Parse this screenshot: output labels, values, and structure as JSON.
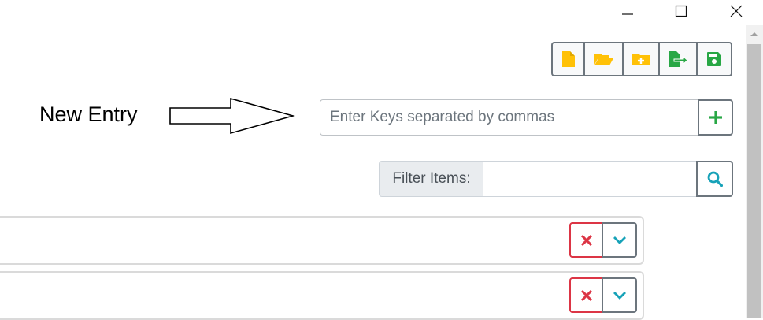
{
  "window": {
    "controls": [
      "minimize-icon",
      "maximize-icon",
      "close-icon"
    ]
  },
  "toolbar": {
    "buttons": [
      {
        "name": "new-file",
        "icon": "file-icon",
        "color": "#ffc107"
      },
      {
        "name": "open-folder",
        "icon": "folder-open-icon",
        "color": "#ffc107"
      },
      {
        "name": "add-folder",
        "icon": "folder-plus-icon",
        "color": "#ffc107"
      },
      {
        "name": "export",
        "icon": "file-export-icon",
        "color": "#28a745"
      },
      {
        "name": "save",
        "icon": "save-icon",
        "color": "#28a745"
      }
    ]
  },
  "new_entry": {
    "label": "New Entry",
    "placeholder": "Enter Keys separated by commas",
    "value": "",
    "add_icon": "plus-icon"
  },
  "filter": {
    "label": "Filter Items:",
    "value": "",
    "search_icon": "search-icon"
  },
  "entries": [
    {
      "delete_icon": "x-icon",
      "expand_icon": "chevron-down-icon"
    },
    {
      "delete_icon": "x-icon",
      "expand_icon": "chevron-down-icon"
    }
  ],
  "colors": {
    "danger": "#dc3545",
    "info": "#17a2b8",
    "success": "#28a745",
    "warning": "#ffc107",
    "border": "#6c757d"
  }
}
